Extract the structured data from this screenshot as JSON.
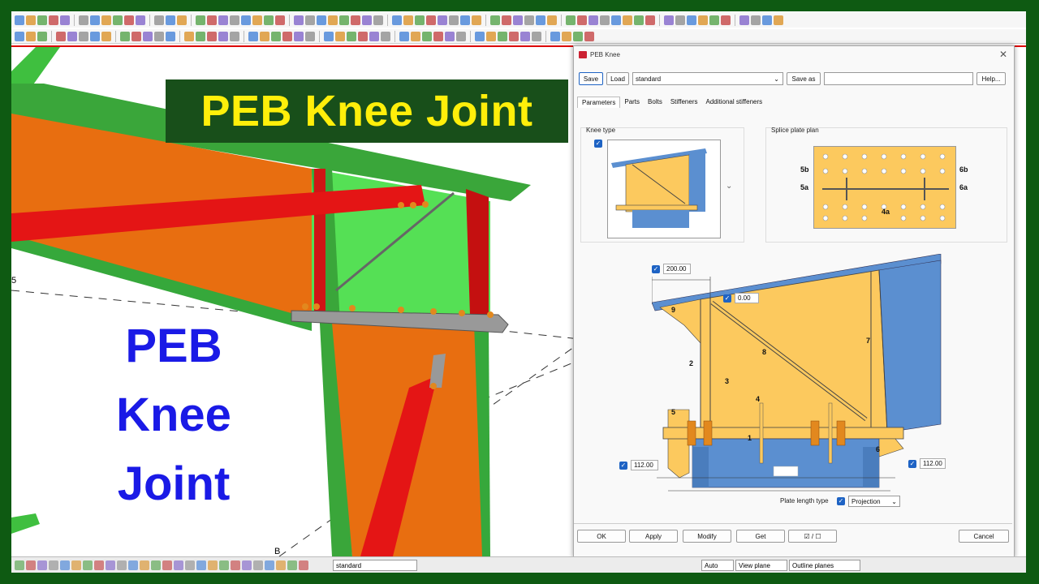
{
  "banner": {
    "title": "PEB Knee Joint"
  },
  "overlay": {
    "line1": "PEB",
    "line2": "Knee",
    "line3": "Joint"
  },
  "grid": {
    "label_5": "5",
    "label_b": "B"
  },
  "dialog": {
    "title": "PEB Knee",
    "save_label": "Save",
    "load_label": "Load",
    "preset_value": "standard",
    "save_as_label": "Save as",
    "save_as_value": "",
    "help_label": "Help...",
    "tabs": [
      "Parameters",
      "Parts",
      "Bolts",
      "Stiffeners",
      "Additional stiffeners"
    ],
    "knee_type_label": "Knee type",
    "splice_plate_plan_label": "Splice plate plan",
    "splice_labels": {
      "l5b": "5b",
      "l5a": "5a",
      "r6b": "6b",
      "r6a": "6a",
      "c4a": "4a"
    },
    "dim_top": "200.00",
    "dim_offset": "0.00",
    "dim_left": "112.00",
    "dim_right": "112.00",
    "part_labels": {
      "p1": "1",
      "p2": "2",
      "p3": "3",
      "p4": "4",
      "p5": "5",
      "p6": "6",
      "p7": "7",
      "p8": "8",
      "p9": "9"
    },
    "plate_length_type_label": "Plate length type",
    "plate_length_type_value": "Projection",
    "ok_label": "OK",
    "apply_label": "Apply",
    "modify_label": "Modify",
    "get_label": "Get",
    "toggle_label": "☑ / ☐",
    "cancel_label": "Cancel"
  },
  "statusbar": {
    "preset_value": "standard",
    "snap_value": "Auto",
    "view_plane_value": "View plane",
    "outline_value": "Outline planes"
  },
  "colors": {
    "frame": "#0e5a12",
    "banner_bg": "#184f1a",
    "banner_text": "#ffef0a",
    "overlay_text": "#1a1ae6",
    "plate": "#fcc95e",
    "beam": "#5b8fd0"
  }
}
